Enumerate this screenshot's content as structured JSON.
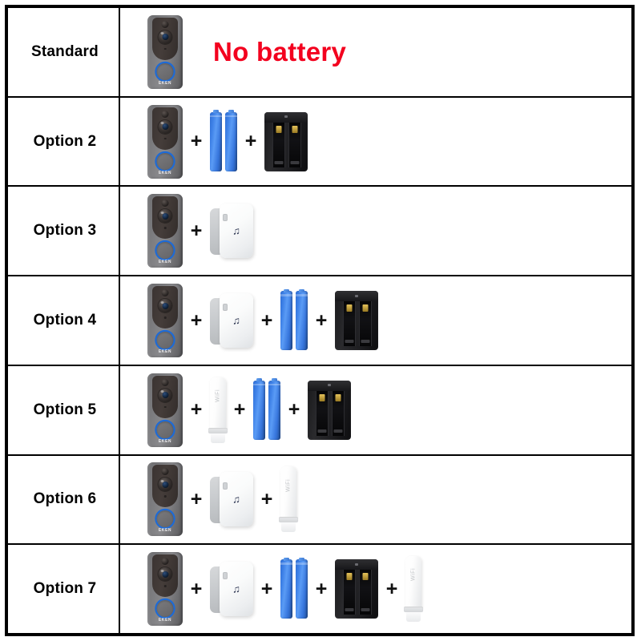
{
  "table": {
    "accent_red": "#f3001e",
    "border_color": "#000000",
    "background": "#ffffff",
    "rows": [
      {
        "label": "Standard",
        "items": [
          {
            "type": "doorbell",
            "name": "video-doorbell",
            "brand": "EKEN"
          }
        ],
        "note": "No battery"
      },
      {
        "label": "Option 2",
        "items": [
          {
            "type": "doorbell",
            "name": "video-doorbell",
            "brand": "EKEN"
          },
          {
            "type": "plus",
            "name": "plus-sign",
            "glyph": "+"
          },
          {
            "type": "batteries",
            "name": "battery-pair",
            "count": 2
          },
          {
            "type": "plus",
            "name": "plus-sign",
            "glyph": "+"
          },
          {
            "type": "charger",
            "name": "battery-charger",
            "bays": 2
          }
        ],
        "note": ""
      },
      {
        "label": "Option 3",
        "items": [
          {
            "type": "doorbell",
            "name": "video-doorbell",
            "brand": "EKEN"
          },
          {
            "type": "plus",
            "name": "plus-sign",
            "glyph": "+"
          },
          {
            "type": "chime",
            "name": "wireless-chime",
            "icon": "music-note"
          }
        ],
        "note": ""
      },
      {
        "label": "Option 4",
        "items": [
          {
            "type": "doorbell",
            "name": "video-doorbell",
            "brand": "EKEN"
          },
          {
            "type": "plus",
            "name": "plus-sign",
            "glyph": "+"
          },
          {
            "type": "chime",
            "name": "wireless-chime",
            "icon": "music-note"
          },
          {
            "type": "plus",
            "name": "plus-sign",
            "glyph": "+"
          },
          {
            "type": "batteries",
            "name": "battery-pair",
            "count": 2
          },
          {
            "type": "plus",
            "name": "plus-sign",
            "glyph": "+"
          },
          {
            "type": "charger",
            "name": "battery-charger",
            "bays": 2
          }
        ],
        "note": ""
      },
      {
        "label": "Option 5",
        "items": [
          {
            "type": "doorbell",
            "name": "video-doorbell",
            "brand": "EKEN"
          },
          {
            "type": "plus",
            "name": "plus-sign",
            "glyph": "+"
          },
          {
            "type": "wifi",
            "name": "wifi-extender",
            "label": "WiFi"
          },
          {
            "type": "plus",
            "name": "plus-sign",
            "glyph": "+"
          },
          {
            "type": "batteries",
            "name": "battery-pair",
            "count": 2
          },
          {
            "type": "plus",
            "name": "plus-sign",
            "glyph": "+"
          },
          {
            "type": "charger",
            "name": "battery-charger",
            "bays": 2
          }
        ],
        "note": ""
      },
      {
        "label": "Option 6",
        "items": [
          {
            "type": "doorbell",
            "name": "video-doorbell",
            "brand": "EKEN"
          },
          {
            "type": "plus",
            "name": "plus-sign",
            "glyph": "+"
          },
          {
            "type": "chime",
            "name": "wireless-chime",
            "icon": "music-note"
          },
          {
            "type": "plus",
            "name": "plus-sign",
            "glyph": "+"
          },
          {
            "type": "wifi",
            "name": "wifi-extender",
            "label": "WiFi"
          }
        ],
        "note": ""
      },
      {
        "label": "Option 7",
        "items": [
          {
            "type": "doorbell",
            "name": "video-doorbell",
            "brand": "EKEN"
          },
          {
            "type": "plus",
            "name": "plus-sign",
            "glyph": "+"
          },
          {
            "type": "chime",
            "name": "wireless-chime",
            "icon": "music-note"
          },
          {
            "type": "plus",
            "name": "plus-sign",
            "glyph": "+"
          },
          {
            "type": "batteries",
            "name": "battery-pair",
            "count": 2
          },
          {
            "type": "plus",
            "name": "plus-sign",
            "glyph": "+"
          },
          {
            "type": "charger",
            "name": "battery-charger",
            "bays": 2
          },
          {
            "type": "plus",
            "name": "plus-sign",
            "glyph": "+"
          },
          {
            "type": "wifi",
            "name": "wifi-extender",
            "label": "WiFi"
          }
        ],
        "note": ""
      }
    ]
  }
}
